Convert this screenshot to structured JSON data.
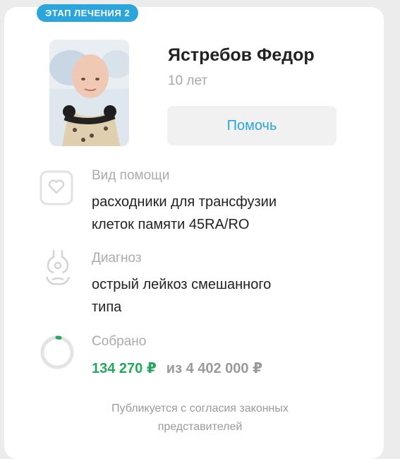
{
  "stage": {
    "label": "ЭТАП ЛЕЧЕНИЯ 2"
  },
  "person": {
    "name": "Ястребов Федор",
    "age": "10 лет"
  },
  "help_button": {
    "label": "Помочь"
  },
  "aid_type": {
    "label": "Вид помощи",
    "line1": "расходники для трансфузии",
    "line2": "клеток памяти 45RA/RO"
  },
  "diagnosis": {
    "label": "Диагноз",
    "line1": "острый лейкоз смешанного",
    "line2": "типа"
  },
  "funds": {
    "label": "Собрано",
    "raised": "134 270 ₽",
    "goal": "из 4 402 000 ₽",
    "progress_fraction": 0.0305
  },
  "footer": {
    "line1": "Публикуется с согласия законных",
    "line2": "представителей"
  },
  "colors": {
    "accent": "#2aa6dc",
    "raised": "#24a85f",
    "muted": "#ababab"
  },
  "icons": [
    "heart-icon",
    "body-diagnosis-icon",
    "progress-ring-icon"
  ]
}
